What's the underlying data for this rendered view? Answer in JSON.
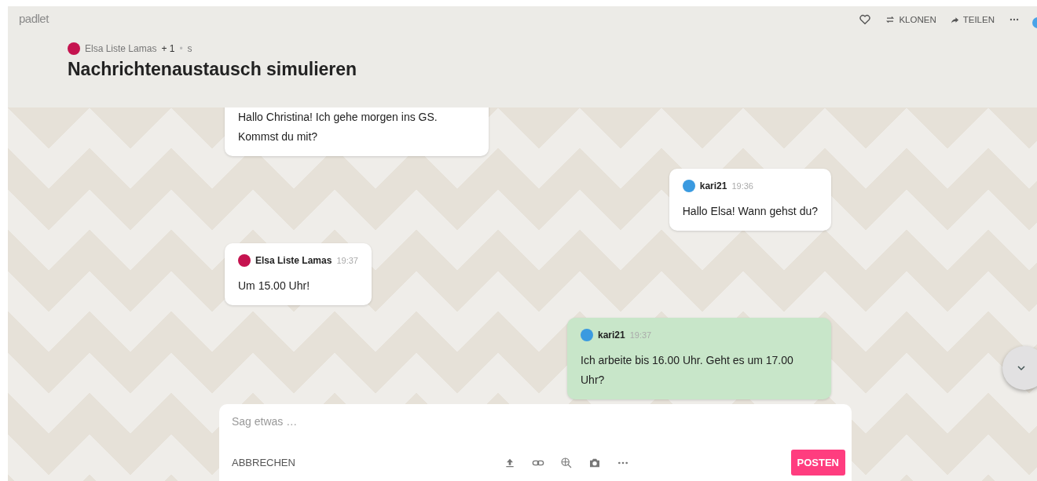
{
  "app": {
    "logo": "padlet"
  },
  "toolbar": {
    "actions": [
      {
        "kind": "like"
      },
      {
        "kind": "clone",
        "label": "KLONEN"
      },
      {
        "kind": "share",
        "label": "TEILEN"
      },
      {
        "kind": "more"
      }
    ]
  },
  "board": {
    "author": "Elsa Liste Lamas",
    "extra": "+ 1",
    "separator": "•",
    "suffix": "s",
    "title": "Nachrichtenaustausch simulieren"
  },
  "messages": [
    {
      "kind": "incoming",
      "highlighted": false,
      "body": "Hallo Christina! Ich gehe morgen ins GS. Kommst du mit?"
    },
    {
      "kind": "outgoing",
      "highlighted": false,
      "author": "kari21",
      "color": "#3a9ae0",
      "time": "19:36",
      "body": "Hallo Elsa! Wann gehst du?"
    },
    {
      "kind": "incoming",
      "highlighted": false,
      "author": "Elsa Liste Lamas",
      "color": "#c5134f",
      "time": "19:37",
      "body": "Um 15.00 Uhr!"
    },
    {
      "kind": "outgoing",
      "highlighted": true,
      "author": "kari21",
      "color": "#3a9ae0",
      "time": "19:37",
      "body": "Ich arbeite bis 16.00 Uhr. Geht es um 17.00 Uhr?"
    }
  ],
  "composer": {
    "placeholder": "Sag etwas …",
    "cancel": "ABBRECHEN",
    "tools": [
      {
        "kind": "upload"
      },
      {
        "kind": "link"
      },
      {
        "kind": "search"
      },
      {
        "kind": "camera"
      },
      {
        "kind": "more"
      }
    ],
    "submit": "POSTEN"
  }
}
